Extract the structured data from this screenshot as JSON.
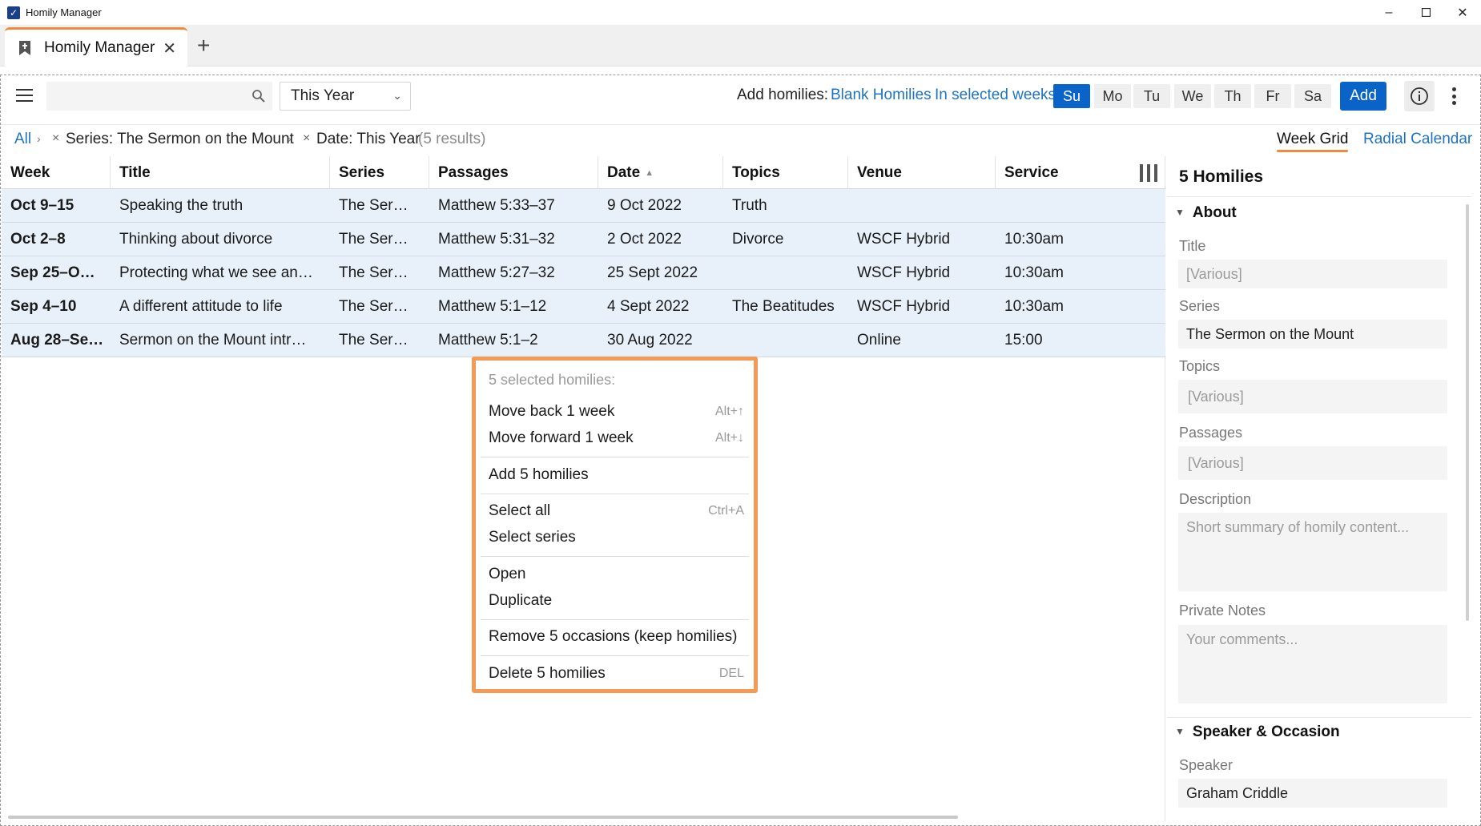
{
  "window": {
    "title": "Homily Manager"
  },
  "tabs": [
    {
      "label": "Homily Manager"
    }
  ],
  "toolbar": {
    "search_value": "",
    "search_placeholder": "",
    "date_filter": "This Year",
    "add_homilies_label": "Add homilies:",
    "blank_homilies_link": "Blank Homilies",
    "in_selected_weeks_link": "In selected weeks",
    "days": [
      "Su",
      "Mo",
      "Tu",
      "We",
      "Th",
      "Fr",
      "Sa"
    ],
    "selected_day": "Su",
    "add_button": "Add"
  },
  "filters": {
    "all": "All",
    "series_filter": "Series: The Sermon on the Mount",
    "date_filter": "Date: This Year",
    "results": "(5 results)",
    "views": [
      "Week Grid",
      "Radial Calendar"
    ],
    "active_view": "Week Grid"
  },
  "table": {
    "columns": [
      "Week",
      "Title",
      "Series",
      "Passages",
      "Date",
      "Topics",
      "Venue",
      "Service"
    ],
    "sorted_column": "Date",
    "sort_direction": "ascending",
    "rows": [
      {
        "week": "Oct 9–15",
        "title": "Speaking the truth",
        "series": "The Ser…",
        "passages": "Matthew 5:33–37",
        "date": "9 Oct 2022",
        "topics": "Truth",
        "venue": "",
        "service": ""
      },
      {
        "week": "Oct 2–8",
        "title": "Thinking about divorce",
        "series": "The Ser…",
        "passages": "Matthew 5:31–32",
        "date": "2 Oct 2022",
        "topics": "Divorce",
        "venue": "WSCF Hybrid",
        "service": "10:30am"
      },
      {
        "week": "Sep 25–O…",
        "title": "Protecting what we see an…",
        "series": "The Ser…",
        "passages": "Matthew 5:27–32",
        "date": "25 Sept 2022",
        "topics": "",
        "venue": "WSCF Hybrid",
        "service": "10:30am"
      },
      {
        "week": "Sep 4–10",
        "title": "A different attitude to life",
        "series": "The Ser…",
        "passages": "Matthew 5:1–12",
        "date": "4 Sept 2022",
        "topics": "The Beatitudes",
        "venue": "WSCF Hybrid",
        "service": "10:30am"
      },
      {
        "week": "Aug 28–Se…",
        "title": "Sermon on the Mount intr…",
        "series": "The Ser…",
        "passages": "Matthew 5:1–2",
        "date": "30 Aug 2022",
        "topics": "",
        "venue": "Online",
        "service": "15:00"
      }
    ]
  },
  "context_menu": {
    "header": "5 selected homilies:",
    "move_back": {
      "label": "Move back 1 week",
      "shortcut": "Alt+↑"
    },
    "move_forward": {
      "label": "Move forward 1 week",
      "shortcut": "Alt+↓"
    },
    "add": {
      "label": "Add 5 homilies"
    },
    "select_all": {
      "label": "Select all",
      "shortcut": "Ctrl+A"
    },
    "select_series": {
      "label": "Select series"
    },
    "open": {
      "label": "Open"
    },
    "duplicate": {
      "label": "Duplicate"
    },
    "remove": {
      "label": "Remove 5 occasions (keep homilies)"
    },
    "delete": {
      "label": "Delete 5 homilies",
      "shortcut": "DEL"
    }
  },
  "panel": {
    "title": "5 Homilies",
    "about_section": "About",
    "title_label": "Title",
    "title_value": "[Various]",
    "series_label": "Series",
    "series_value": "The Sermon on the Mount",
    "topics_label": "Topics",
    "topics_value": "[Various]",
    "passages_label": "Passages",
    "passages_value": "[Various]",
    "description_label": "Description",
    "description_placeholder": "Short summary of homily content...",
    "notes_label": "Private Notes",
    "notes_placeholder": "Your comments...",
    "speaker_section": "Speaker & Occasion",
    "speaker_label": "Speaker",
    "speaker_value": "Graham Criddle"
  },
  "colors": {
    "accent_blue": "#0a63c9",
    "link_blue": "#1e73c2",
    "accent_orange": "#f08a3c",
    "selection_row": "#e8f1fa"
  }
}
